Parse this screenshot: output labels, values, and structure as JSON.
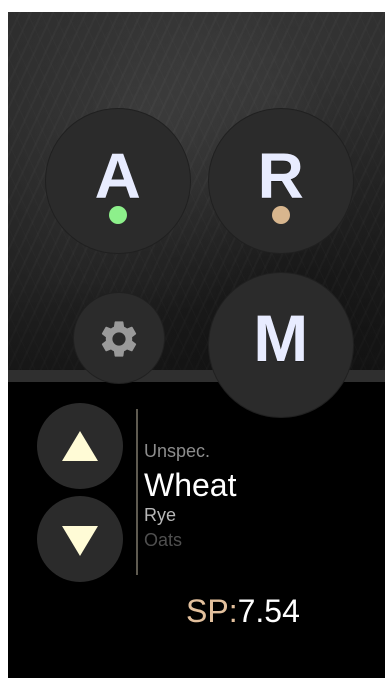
{
  "hero": {
    "buttons": {
      "a": {
        "label": "A",
        "status_dot_color": "#8df08b"
      },
      "r": {
        "label": "R",
        "status_dot_color": "#d8b68e"
      },
      "m": {
        "label": "M"
      }
    },
    "icons": {
      "settings": "gear-icon"
    }
  },
  "picker": {
    "up_icon": "triangle-up-icon",
    "down_icon": "triangle-down-icon",
    "items": [
      "Unspec.",
      "Wheat",
      "Rye",
      "Oats"
    ],
    "selected_index": 1
  },
  "sp": {
    "label": "SP:",
    "value": "7.54"
  },
  "colors": {
    "background": "#000000",
    "circle_bg": "#2b2b2b",
    "text_primary": "#ffffff",
    "text_dim": "#8d8d8d",
    "text_muted": "#b8b8b8",
    "text_disabled": "#4f4f4f",
    "sp_label": "#e3c09d",
    "triangle_fill": "#fffbd6",
    "gear_fill": "#9a9a9a",
    "divider": "#6f6a5e"
  }
}
